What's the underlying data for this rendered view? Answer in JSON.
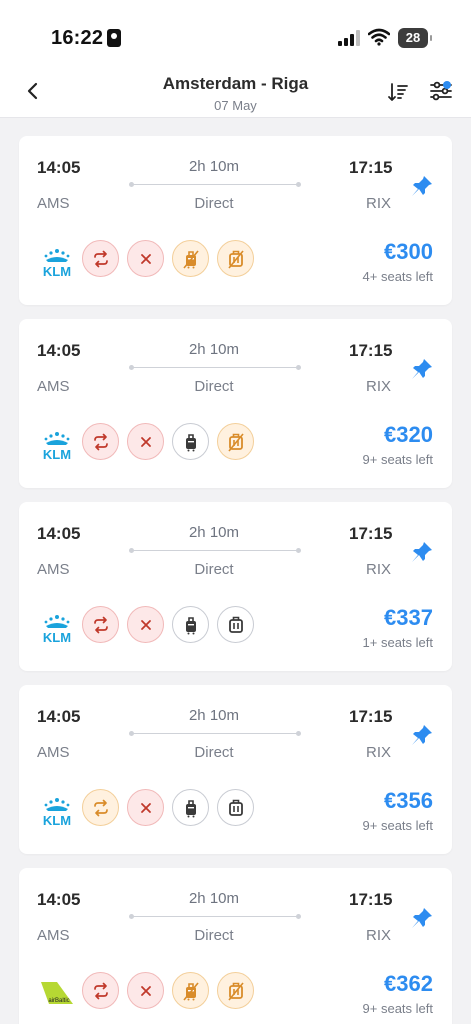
{
  "status": {
    "time": "16:22",
    "battery": "28"
  },
  "header": {
    "title": "Amsterdam - Riga",
    "subtitle": "07 May"
  },
  "colors": {
    "accent": "#2d8cf0",
    "klm": "#1aa3dc",
    "airbaltic": "#b6d833"
  },
  "flights": [
    {
      "dep_time": "14:05",
      "arr_time": "17:15",
      "duration": "2h 10m",
      "dep_code": "AMS",
      "arr_code": "RIX",
      "stops": "Direct",
      "airline": "KLM",
      "price": "€300",
      "seats": "4+ seats left",
      "amenities": [
        "change-red",
        "refund-red",
        "carryon-orange",
        "checked-orange"
      ]
    },
    {
      "dep_time": "14:05",
      "arr_time": "17:15",
      "duration": "2h 10m",
      "dep_code": "AMS",
      "arr_code": "RIX",
      "stops": "Direct",
      "airline": "KLM",
      "price": "€320",
      "seats": "9+ seats left",
      "amenities": [
        "change-red",
        "refund-red",
        "carryon-grey",
        "checked-orange"
      ]
    },
    {
      "dep_time": "14:05",
      "arr_time": "17:15",
      "duration": "2h 10m",
      "dep_code": "AMS",
      "arr_code": "RIX",
      "stops": "Direct",
      "airline": "KLM",
      "price": "€337",
      "seats": "1+ seats left",
      "amenities": [
        "change-red",
        "refund-red",
        "carryon-grey",
        "checked-grey"
      ]
    },
    {
      "dep_time": "14:05",
      "arr_time": "17:15",
      "duration": "2h 10m",
      "dep_code": "AMS",
      "arr_code": "RIX",
      "stops": "Direct",
      "airline": "KLM",
      "price": "€356",
      "seats": "9+ seats left",
      "amenities": [
        "change-orange",
        "refund-red",
        "carryon-grey",
        "checked-grey"
      ]
    },
    {
      "dep_time": "14:05",
      "arr_time": "17:15",
      "duration": "2h 10m",
      "dep_code": "AMS",
      "arr_code": "RIX",
      "stops": "Direct",
      "airline": "airBaltic",
      "price": "€362",
      "seats": "9+ seats left",
      "amenities": [
        "change-red",
        "refund-red",
        "carryon-orange",
        "checked-orange"
      ]
    }
  ]
}
